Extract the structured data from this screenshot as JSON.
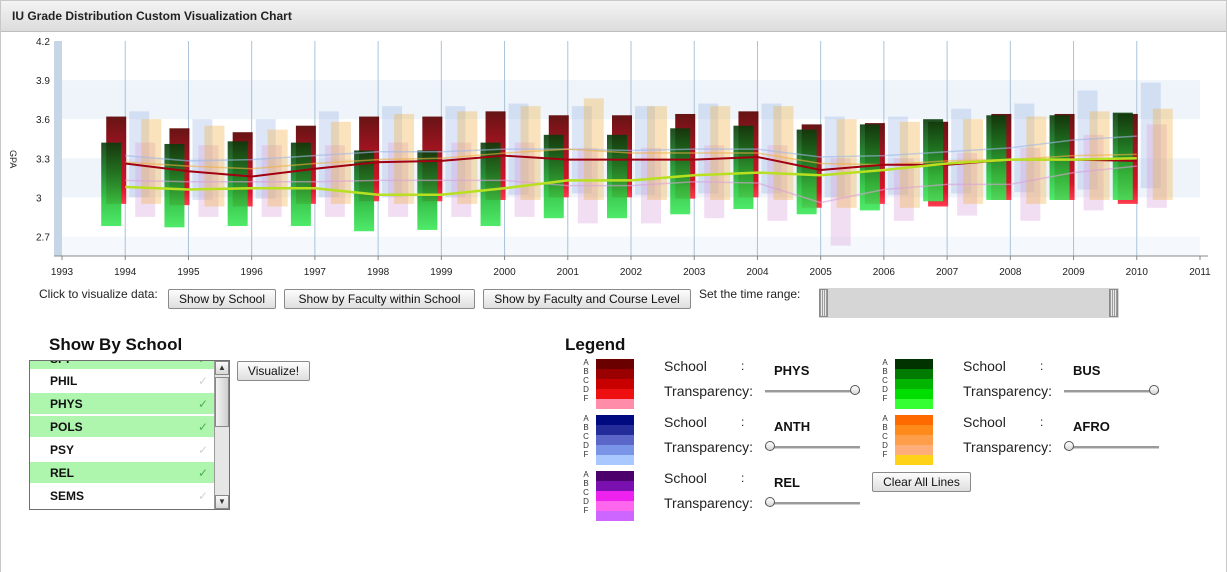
{
  "window": {
    "title": "IU Grade Distribution Custom Visualization Chart"
  },
  "chart_data": {
    "type": "bar",
    "ylabel": "GPA",
    "ylim": [
      2.55,
      4.2
    ],
    "yticks": [
      2.7,
      3,
      3.3,
      3.6,
      3.9,
      4.2
    ],
    "xticks": [
      "1993",
      "1994",
      "1995",
      "1996",
      "1997",
      "1998",
      "1999",
      "2000",
      "2001",
      "2002",
      "2003",
      "2004",
      "2005",
      "2006",
      "2007",
      "2008",
      "2009",
      "2010",
      "2011"
    ],
    "years": [
      1994,
      1995,
      1996,
      1997,
      1998,
      1999,
      2000,
      2001,
      2002,
      2003,
      2004,
      2005,
      2006,
      2007,
      2008,
      2009,
      2010
    ],
    "series": [
      {
        "name": "PHYS",
        "color": "#8b0000",
        "low": [
          2.95,
          2.94,
          2.93,
          2.95,
          2.97,
          2.97,
          2.98,
          3.0,
          3.0,
          2.99,
          3.0,
          2.92,
          2.95,
          2.93,
          2.98,
          2.98,
          2.95
        ],
        "high": [
          3.62,
          3.53,
          3.5,
          3.55,
          3.62,
          3.62,
          3.66,
          3.63,
          3.63,
          3.64,
          3.66,
          3.56,
          3.57,
          3.58,
          3.64,
          3.64,
          3.64
        ],
        "mean": [
          3.26,
          3.2,
          3.16,
          3.22,
          3.27,
          3.28,
          3.32,
          3.29,
          3.29,
          3.29,
          3.31,
          3.21,
          3.25,
          3.25,
          3.29,
          3.29,
          3.28
        ]
      },
      {
        "name": "BUS",
        "color": "#1e9e2e",
        "low": [
          2.78,
          2.77,
          2.78,
          2.78,
          2.74,
          2.75,
          2.78,
          2.84,
          2.84,
          2.87,
          2.91,
          2.87,
          2.9,
          2.97,
          2.98,
          2.98,
          2.98
        ],
        "high": [
          3.42,
          3.41,
          3.43,
          3.42,
          3.36,
          3.36,
          3.42,
          3.48,
          3.48,
          3.53,
          3.55,
          3.52,
          3.56,
          3.6,
          3.63,
          3.63,
          3.65
        ],
        "mean": [
          3.08,
          3.06,
          3.07,
          3.07,
          3.02,
          3.02,
          3.07,
          3.13,
          3.13,
          3.17,
          3.19,
          3.17,
          3.21,
          3.26,
          3.29,
          3.29,
          3.3
        ]
      },
      {
        "name": "ANTH",
        "color": "#9fb7e6",
        "low": [
          3.0,
          2.98,
          2.99,
          3.0,
          3.0,
          3.0,
          3.02,
          3.03,
          3.02,
          3.03,
          3.03,
          3.0,
          3.02,
          3.03,
          3.04,
          3.06,
          3.07
        ],
        "high": [
          3.66,
          3.6,
          3.6,
          3.66,
          3.7,
          3.7,
          3.72,
          3.7,
          3.7,
          3.72,
          3.72,
          3.62,
          3.62,
          3.68,
          3.72,
          3.82,
          3.88
        ],
        "mean": [
          3.32,
          3.28,
          3.29,
          3.32,
          3.35,
          3.35,
          3.37,
          3.37,
          3.36,
          3.37,
          3.37,
          3.31,
          3.32,
          3.35,
          3.38,
          3.44,
          3.47
        ]
      },
      {
        "name": "REL",
        "color": "#d9a0d9",
        "low": [
          2.85,
          2.85,
          2.85,
          2.85,
          2.85,
          2.85,
          2.85,
          2.8,
          2.8,
          2.84,
          2.82,
          2.63,
          2.82,
          2.86,
          2.82,
          2.9,
          2.92
        ],
        "high": [
          3.42,
          3.4,
          3.4,
          3.4,
          3.42,
          3.42,
          3.42,
          3.38,
          3.38,
          3.4,
          3.4,
          3.3,
          3.3,
          3.34,
          3.38,
          3.48,
          3.56
        ],
        "mean": [
          3.13,
          3.12,
          3.12,
          3.12,
          3.13,
          3.13,
          3.13,
          3.09,
          3.09,
          3.12,
          3.11,
          2.96,
          3.06,
          3.1,
          3.1,
          3.19,
          3.24
        ]
      },
      {
        "name": "AFRO",
        "color": "#f0b040",
        "low": [
          2.95,
          2.93,
          2.93,
          2.95,
          2.95,
          2.95,
          2.98,
          2.98,
          2.98,
          2.98,
          2.98,
          2.92,
          2.92,
          2.95,
          2.95,
          2.98,
          2.98
        ],
        "high": [
          3.6,
          3.55,
          3.52,
          3.58,
          3.64,
          3.66,
          3.7,
          3.76,
          3.7,
          3.7,
          3.7,
          3.6,
          3.58,
          3.6,
          3.62,
          3.66,
          3.68
        ],
        "mean": [
          3.27,
          3.24,
          3.22,
          3.26,
          3.29,
          3.3,
          3.34,
          3.37,
          3.34,
          3.34,
          3.34,
          3.26,
          3.25,
          3.28,
          3.29,
          3.32,
          3.33
        ]
      }
    ]
  },
  "controls": {
    "visualize_label": "Click to visualize data:",
    "show_by_school": "Show by School",
    "show_by_faculty": "Show by Faculty within School",
    "show_by_faculty_course": "Show by Faculty and Course Level",
    "time_range_label": "Set the time range:"
  },
  "school_list": {
    "heading": "Show By School",
    "visualize_button": "Visualize!",
    "items": [
      {
        "label": "SPP",
        "selected": true,
        "check": "✓"
      },
      {
        "label": "PHIL",
        "selected": false,
        "check": "✓"
      },
      {
        "label": "PHYS",
        "selected": true,
        "check": "✓"
      },
      {
        "label": "POLS",
        "selected": true,
        "check": "✓"
      },
      {
        "label": "PSY",
        "selected": false,
        "check": "✓"
      },
      {
        "label": "REL",
        "selected": true,
        "check": "✓"
      },
      {
        "label": "SEMS",
        "selected": false,
        "check": "✓"
      }
    ]
  },
  "legend": {
    "heading": "Legend",
    "grade_letters": "ABCDF",
    "school_label": "School",
    "colon": ":",
    "transparency_label": "Transparency:",
    "clear_button": "Clear All Lines",
    "entries": [
      {
        "school": "PHYS",
        "transparency": 0.95,
        "swatches": [
          "#6b0000",
          "#9a0000",
          "#c80000",
          "#ee1010",
          "#ff8ca8"
        ]
      },
      {
        "school": "BUS",
        "transparency": 0.95,
        "swatches": [
          "#003300",
          "#007a00",
          "#00b400",
          "#00dd00",
          "#33ff33"
        ]
      },
      {
        "school": "ANTH",
        "transparency": 0.0,
        "swatches": [
          "#000a80",
          "#242c9a",
          "#5a66c8",
          "#7a95e8",
          "#a8c8ff"
        ]
      },
      {
        "school": "AFRO",
        "transparency": 0.0,
        "swatches": [
          "#ff6a00",
          "#ff8a1c",
          "#ff9e4a",
          "#ffae7a",
          "#ffd21a"
        ]
      },
      {
        "school": "REL",
        "transparency": 0.0,
        "swatches": [
          "#4b006b",
          "#7a10b0",
          "#ee22ee",
          "#ff66ee",
          "#cc66ff"
        ]
      }
    ]
  }
}
